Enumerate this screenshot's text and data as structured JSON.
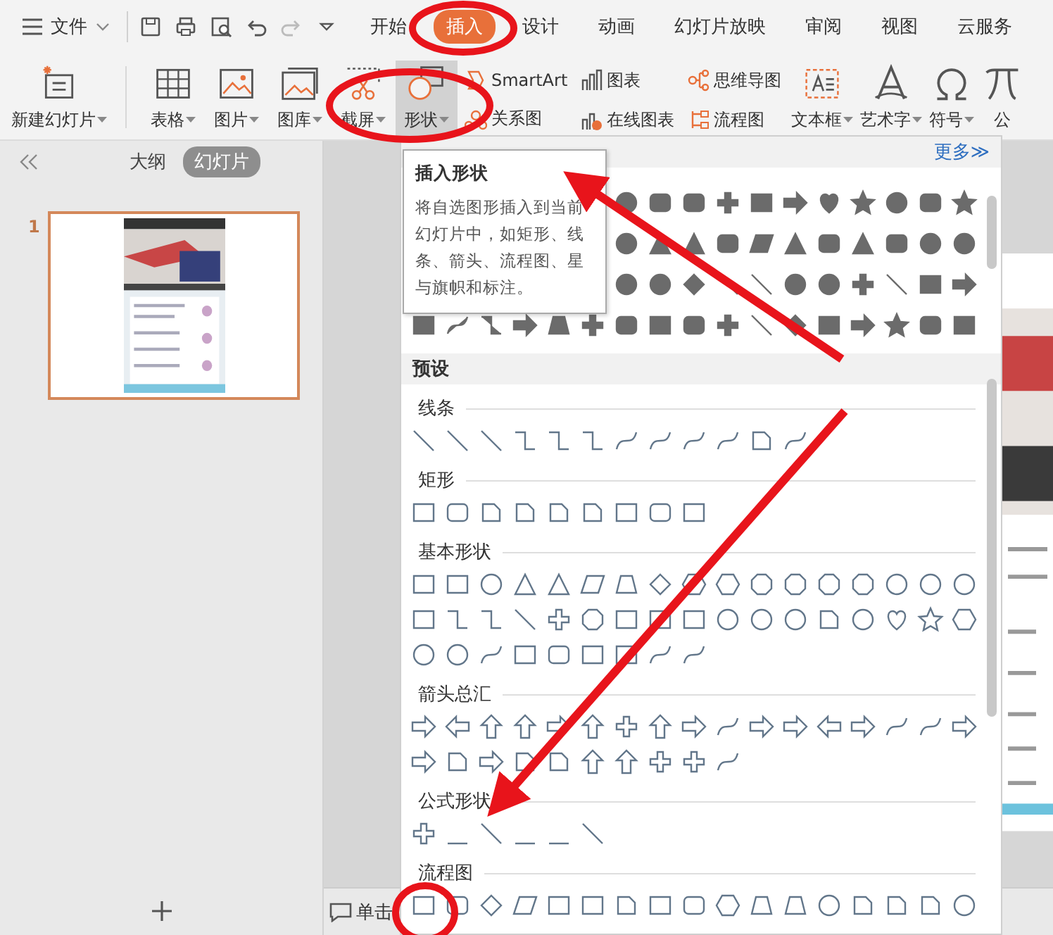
{
  "file_menu": {
    "label": "文件"
  },
  "tabs": [
    {
      "label": "开始",
      "selected": false
    },
    {
      "label": "插入",
      "selected": true
    },
    {
      "label": "设计",
      "selected": false
    },
    {
      "label": "动画",
      "selected": false
    },
    {
      "label": "幻灯片放映",
      "selected": false
    },
    {
      "label": "审阅",
      "selected": false
    },
    {
      "label": "视图",
      "selected": false
    },
    {
      "label": "云服务",
      "selected": false
    }
  ],
  "ribbon": [
    {
      "kind": "large",
      "label": "新建幻灯片",
      "dropdown": true,
      "pressed": false
    },
    {
      "kind": "large",
      "label": "表格",
      "dropdown": true,
      "pressed": false
    },
    {
      "kind": "large",
      "label": "图片",
      "dropdown": true,
      "pressed": false
    },
    {
      "kind": "large",
      "label": "图库",
      "dropdown": true,
      "pressed": false
    },
    {
      "kind": "large",
      "label": "截屏",
      "dropdown": true,
      "pressed": false
    },
    {
      "kind": "large",
      "label": "形状",
      "dropdown": true,
      "pressed": true
    },
    {
      "kind": "pair",
      "items": [
        {
          "label": "SmartArt"
        },
        {
          "label": "关系图"
        }
      ]
    },
    {
      "kind": "pair",
      "items": [
        {
          "label": "图表"
        },
        {
          "label": "在线图表"
        }
      ]
    },
    {
      "kind": "pair",
      "items": [
        {
          "label": "思维导图"
        },
        {
          "label": "流程图"
        }
      ]
    },
    {
      "kind": "large",
      "label": "文本框",
      "dropdown": true,
      "pressed": false
    },
    {
      "kind": "large",
      "label": "艺术字",
      "dropdown": true,
      "pressed": false
    },
    {
      "kind": "large",
      "label": "符号",
      "dropdown": true,
      "pressed": false
    },
    {
      "kind": "large",
      "label": "公",
      "dropdown": false,
      "pressed": false
    }
  ],
  "sidebar": {
    "tabs": [
      {
        "label": "大纲",
        "selected": false
      },
      {
        "label": "幻灯片",
        "selected": true
      }
    ],
    "slides": [
      {
        "number": "1",
        "selected": true
      }
    ]
  },
  "notes_hint": "单击",
  "shapes_panel": {
    "more_link": "更多≫",
    "tooltip": {
      "title": "插入形状",
      "text": "将自选图形插入到当前幻灯片中，如矩形、线条、箭头、流程图、星与旗帜和标注。"
    },
    "preset_title": "预设",
    "sections": [
      {
        "title": "线条"
      },
      {
        "title": "矩形"
      },
      {
        "title": "基本形状"
      },
      {
        "title": "箭头总汇"
      },
      {
        "title": "公式形状"
      },
      {
        "title": "流程图"
      }
    ]
  }
}
